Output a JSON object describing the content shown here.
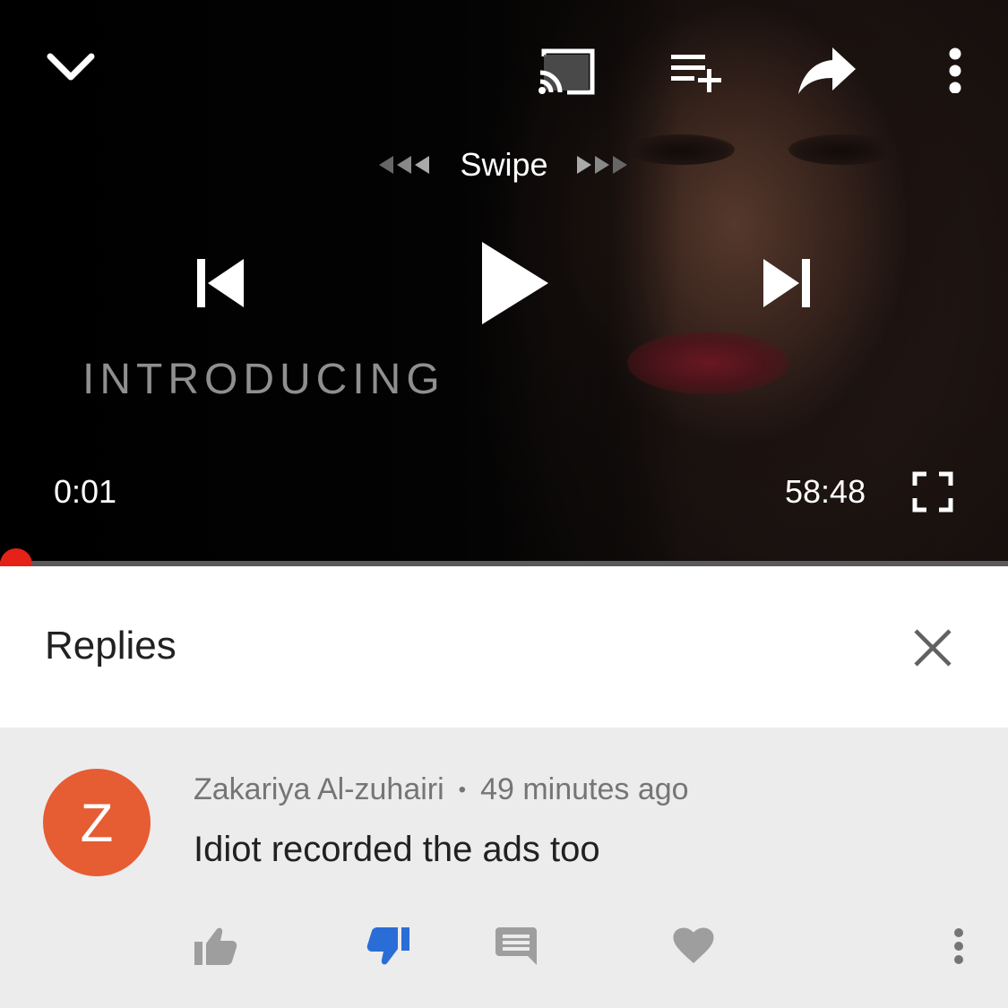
{
  "player": {
    "overlay_text": "INTRODUCING",
    "swipe_label": "Swipe",
    "current_time": "0:01",
    "total_time": "58:48",
    "progress_fraction": 0.0003,
    "icons": {
      "minimize": "chevron-down-icon",
      "cast": "cast-icon",
      "add_to_queue": "playlist-add-icon",
      "share": "share-icon",
      "more": "more-vert-icon",
      "previous": "skip-previous-icon",
      "play": "play-icon",
      "next": "skip-next-icon",
      "fullscreen": "fullscreen-icon"
    },
    "accent_color": "#e62117"
  },
  "replies": {
    "title": "Replies",
    "close_icon": "close-icon"
  },
  "comment": {
    "avatar_letter": "Z",
    "avatar_color": "#e65c33",
    "author": "Zakariya Al-zuhairi",
    "separator": "•",
    "timestamp": "49 minutes ago",
    "text": "Idiot recorded the ads too",
    "actions": {
      "like": "thumb-up-icon",
      "dislike": "thumb-down-icon",
      "reply": "comment-icon",
      "heart": "heart-icon",
      "more": "more-vert-icon"
    },
    "dislike_active_color": "#2a6dd6"
  }
}
